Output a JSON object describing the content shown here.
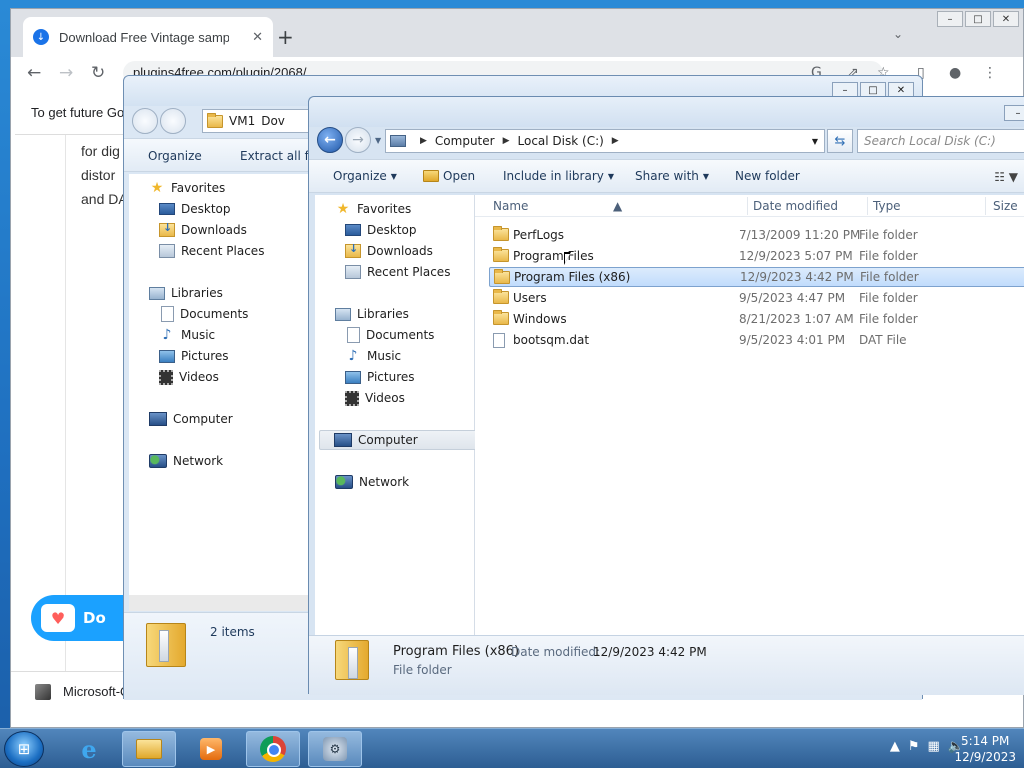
{
  "chrome": {
    "tab_title": "Download Free Vintage sampler",
    "new_tab": "+",
    "url": "plugins4free.com/plugin/2068/",
    "infobar_text": "To get future Go",
    "page_lines": [
      "for dig",
      "distor",
      "and DA"
    ],
    "donate_label": "Do",
    "download_item": "Microsoft-Office-P....exe"
  },
  "explorer_back": {
    "breadcrumb": [
      "VM1",
      "Dov"
    ],
    "commands": [
      "Organize",
      "Extract all file"
    ],
    "nav": {
      "favorites": "Favorites",
      "desktop": "Desktop",
      "downloads": "Downloads",
      "recent": "Recent Places",
      "libraries": "Libraries",
      "documents": "Documents",
      "music": "Music",
      "pictures": "Pictures",
      "videos": "Videos",
      "computer": "Computer",
      "network": "Network"
    },
    "status": "2 items"
  },
  "explorer_front": {
    "breadcrumb": [
      "Computer",
      "Local Disk (C:)"
    ],
    "search_placeholder": "Search Local Disk (C:)",
    "commands": {
      "organize": "Organize",
      "open": "Open",
      "include": "Include in library",
      "share": "Share with",
      "new_folder": "New folder"
    },
    "nav": {
      "favorites": "Favorites",
      "desktop": "Desktop",
      "downloads": "Downloads",
      "recent": "Recent Places",
      "libraries": "Libraries",
      "documents": "Documents",
      "music": "Music",
      "pictures": "Pictures",
      "videos": "Videos",
      "computer": "Computer",
      "network": "Network"
    },
    "columns": [
      "Name",
      "Date modified",
      "Type",
      "Size"
    ],
    "files": [
      {
        "name": "PerfLogs",
        "date": "7/13/2009 11:20 PM",
        "type": "File folder",
        "kind": "folder"
      },
      {
        "name": "Program Files",
        "date": "12/9/2023 5:07 PM",
        "type": "File folder",
        "kind": "folder"
      },
      {
        "name": "Program Files (x86)",
        "date": "12/9/2023 4:42 PM",
        "type": "File folder",
        "kind": "folder"
      },
      {
        "name": "Users",
        "date": "9/5/2023 4:47 PM",
        "type": "File folder",
        "kind": "folder"
      },
      {
        "name": "Windows",
        "date": "8/21/2023 1:07 AM",
        "type": "File folder",
        "kind": "folder"
      },
      {
        "name": "bootsqm.dat",
        "date": "9/5/2023 4:01 PM",
        "type": "DAT File",
        "kind": "file"
      }
    ],
    "selected_index": 2,
    "details": {
      "name": "Program Files (x86)",
      "date_label": "Date modified:",
      "date_value": "12/9/2023 4:42 PM",
      "type": "File folder"
    }
  },
  "taskbar": {
    "time": "5:14 PM",
    "date": "12/9/2023"
  }
}
